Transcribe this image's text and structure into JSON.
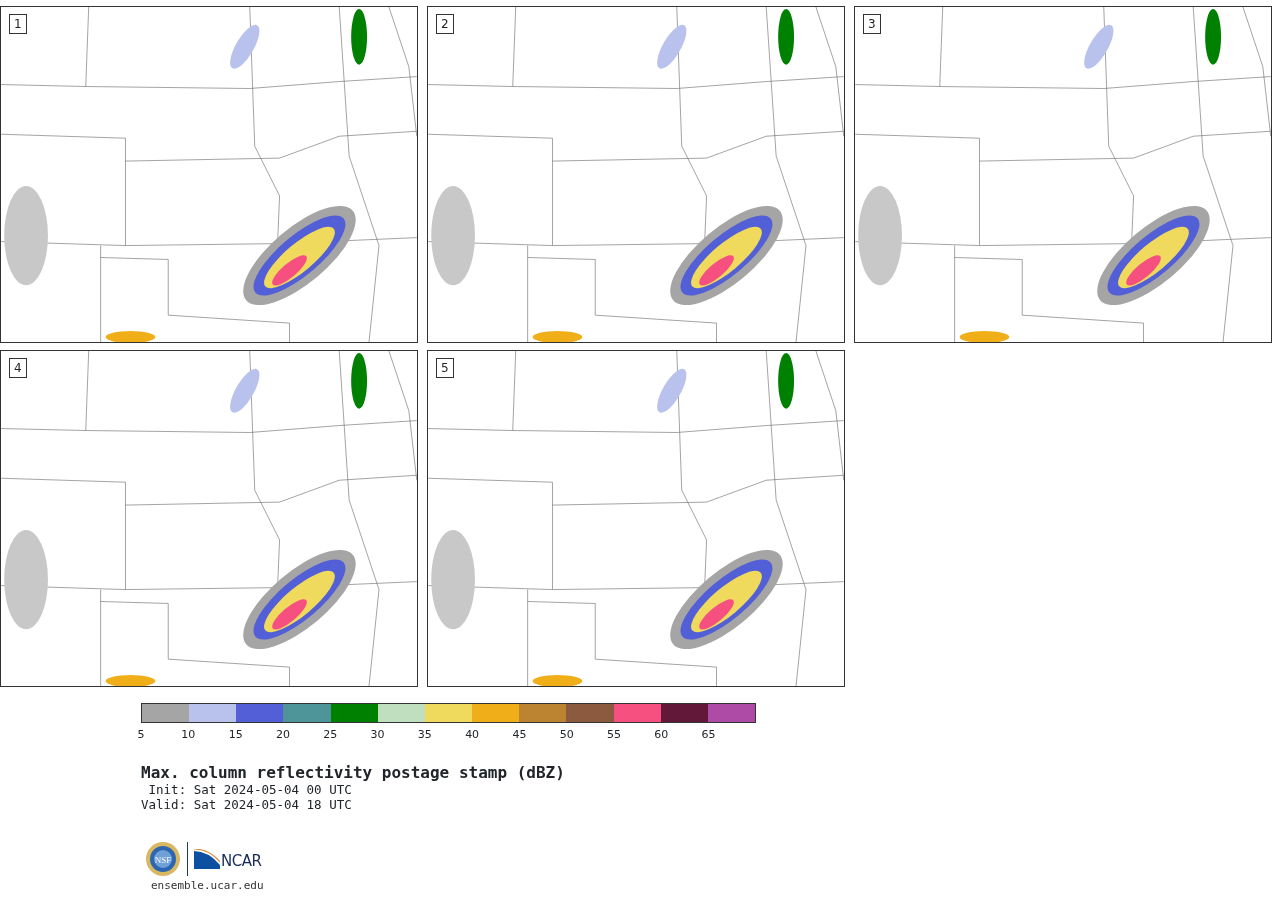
{
  "panels": [
    {
      "label": "1"
    },
    {
      "label": "2"
    },
    {
      "label": "3"
    },
    {
      "label": "4"
    },
    {
      "label": "5"
    }
  ],
  "colorbar": {
    "segments": [
      {
        "color": "#a5a5a5"
      },
      {
        "color": "#b8c2ec"
      },
      {
        "color": "#525fd6"
      },
      {
        "color": "#4e9599"
      },
      {
        "color": "#008000"
      },
      {
        "color": "#bfdfbf"
      },
      {
        "color": "#f0da5e"
      },
      {
        "color": "#f0ae18"
      },
      {
        "color": "#bc8330"
      },
      {
        "color": "#8b5a3f"
      },
      {
        "color": "#f65080"
      },
      {
        "color": "#621839"
      },
      {
        "color": "#ad4ba6"
      }
    ],
    "ticks": [
      "5",
      "10",
      "15",
      "20",
      "25",
      "30",
      "35",
      "40",
      "45",
      "50",
      "55",
      "60",
      "65"
    ]
  },
  "title": "Max. column reflectivity postage stamp (dBZ)",
  "init": " Init: Sat 2024-05-04 00 UTC",
  "valid": "Valid: Sat 2024-05-04 18 UTC",
  "logos": {
    "seal_text": "NSF",
    "brand_text": "NCAR"
  },
  "site": "ensemble.ucar.edu"
}
